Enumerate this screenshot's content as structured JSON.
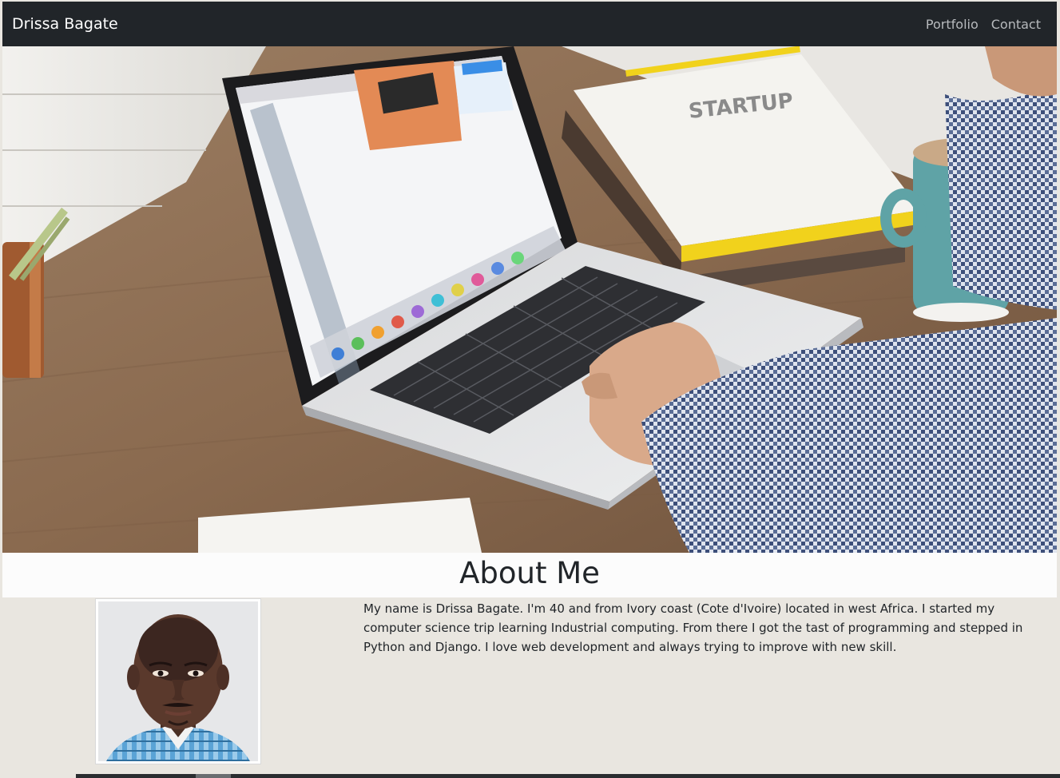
{
  "navbar": {
    "brand": "Drissa Bagate",
    "links": [
      "Portfolio",
      "Contact"
    ]
  },
  "hero": {
    "image": "laptop-desk-photo"
  },
  "about": {
    "title": "About Me",
    "portrait": "profile-photo",
    "bio": "My name is Drissa Bagate. I'm 40 and from Ivory coast (Cote d'Ivoire) located in west Africa. I started my computer science trip learning Industrial computing. From there I got the tast of programming and stepped in Python and Django. I love web development and always trying to improve with new skill."
  },
  "colors": {
    "navbar": "#212529",
    "page_background": "#e9e6e0",
    "text": "#212529"
  }
}
